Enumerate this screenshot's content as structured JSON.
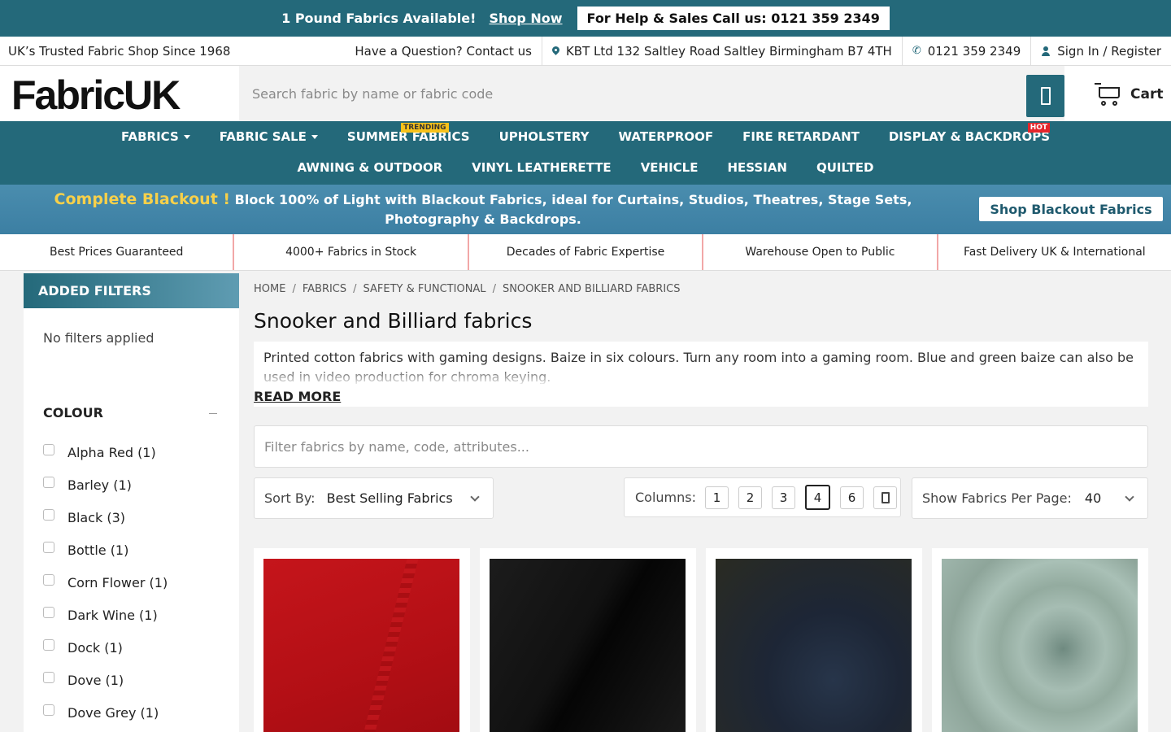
{
  "promo": {
    "text": "1 Pound Fabrics Available!",
    "link": "Shop Now",
    "call": "For Help & Sales Call us: 0121 359 2349"
  },
  "utility": {
    "tagline": "UK’s Trusted Fabric Shop Since 1968",
    "contact": "Have a Question? Contact us",
    "address": "KBT Ltd 132 Saltley Road Saltley Birmingham B7 4TH",
    "phone": "0121 359 2349",
    "signin": "Sign In / Register"
  },
  "header": {
    "logo": "FabricUK",
    "search_placeholder": "Search fabric by name or fabric code",
    "cart": "Cart"
  },
  "nav": {
    "row1": [
      "FABRICS",
      "FABRIC SALE",
      "SUMMER FABRICS",
      "UPHOLSTERY",
      "WATERPROOF",
      "FIRE RETARDANT",
      "DISPLAY & BACKDROPS"
    ],
    "row2": [
      "AWNING & OUTDOOR",
      "VINYL LEATHERETTE",
      "VEHICLE",
      "HESSIAN",
      "QUILTED"
    ],
    "tag_trending": "TRENDING",
    "tag_hot": "HOT"
  },
  "blackout": {
    "highlight": "Complete Blackout !",
    "text": "Block 100% of Light with Blackout Fabrics, ideal for Curtains, Studios, Theatres, Stage Sets, Photography & Backdrops.",
    "button": "Shop Blackout Fabrics"
  },
  "usp": [
    "Best Prices Guaranteed",
    "4000+ Fabrics in Stock",
    "Decades of Fabric Expertise",
    "Warehouse Open to Public",
    "Fast Delivery UK & International"
  ],
  "sidebar": {
    "heading": "ADDED FILTERS",
    "no_filters": "No filters applied",
    "colour_heading": "COLOUR",
    "colours": [
      "Alpha Red (1)",
      "Barley (1)",
      "Black (3)",
      "Bottle (1)",
      "Corn Flower (1)",
      "Dark Wine (1)",
      "Dock (1)",
      "Dove (1)",
      "Dove Grey (1)"
    ]
  },
  "breadcrumb": [
    "HOME",
    "FABRICS",
    "SAFETY & FUNCTIONAL",
    "SNOOKER AND BILLIARD FABRICS"
  ],
  "page": {
    "title": "Snooker and Billiard fabrics",
    "description": "Printed cotton fabrics with gaming designs. Baize in six colours. Turn any room into a gaming room. Blue and green baize can also be used in video production for chroma keying.",
    "read_more": "READ MORE",
    "filter_placeholder": "Filter fabrics by name, code, attributes..."
  },
  "controls": {
    "sort_label": "Sort By:",
    "sort_value": "Best Selling Fabrics",
    "columns_label": "Columns:",
    "columns": [
      "1",
      "2",
      "3",
      "4",
      "6"
    ],
    "columns_selected": "4",
    "per_page_label": "Show Fabrics Per Page:",
    "per_page_value": "40"
  },
  "products": [
    {
      "swatch": "red"
    },
    {
      "swatch": "black"
    },
    {
      "swatch": "navy"
    },
    {
      "swatch": "sage green"
    }
  ],
  "colors": {
    "brand_teal": "#24697a",
    "trending_tag": "#f7c21b",
    "hot_tag": "#e4262c",
    "blackout_highlight": "#f7d04a"
  }
}
